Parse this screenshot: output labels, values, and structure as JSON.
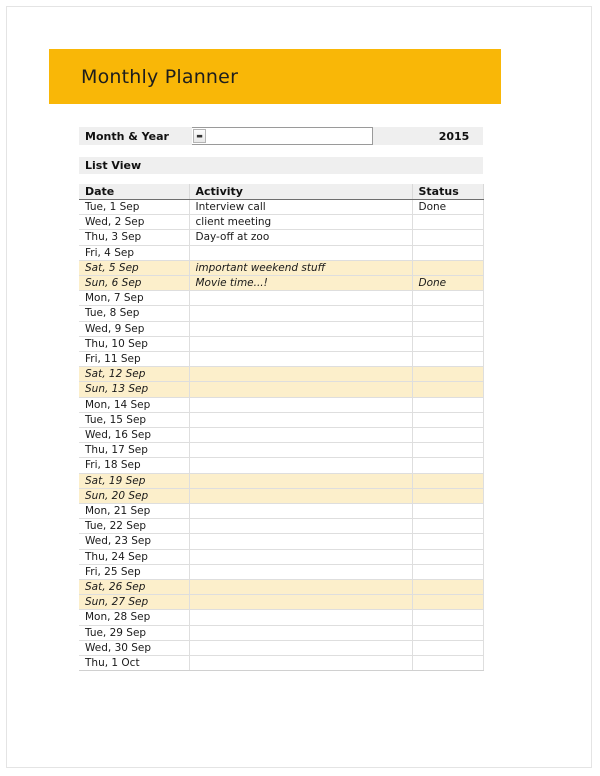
{
  "banner": {
    "title": "Monthly Planner",
    "bg_color": "#f9b707"
  },
  "month_year": {
    "label": "Month & Year",
    "dropdown_icon": "chevron-down-icon",
    "dropdown_glyph": "▬",
    "month_value": "",
    "month_placeholder": "",
    "year": "2015"
  },
  "list_view": {
    "label": "List View"
  },
  "table": {
    "columns": [
      "Date",
      "Activity",
      "Status"
    ],
    "weekend_bg": "#fcefcb",
    "rows": [
      {
        "date": "Tue, 1 Sep",
        "activity": "Interview call",
        "status": "Done",
        "weekend": false
      },
      {
        "date": "Wed, 2 Sep",
        "activity": "client meeting",
        "status": "",
        "weekend": false
      },
      {
        "date": "Thu, 3 Sep",
        "activity": "Day-off at zoo",
        "status": "",
        "weekend": false
      },
      {
        "date": "Fri, 4 Sep",
        "activity": "",
        "status": "",
        "weekend": false
      },
      {
        "date": "Sat, 5 Sep",
        "activity": "important weekend stuff",
        "status": "",
        "weekend": true
      },
      {
        "date": "Sun, 6 Sep",
        "activity": "Movie time...!",
        "status": "Done",
        "weekend": true
      },
      {
        "date": "Mon, 7 Sep",
        "activity": "",
        "status": "",
        "weekend": false
      },
      {
        "date": "Tue, 8 Sep",
        "activity": "",
        "status": "",
        "weekend": false
      },
      {
        "date": "Wed, 9 Sep",
        "activity": "",
        "status": "",
        "weekend": false
      },
      {
        "date": "Thu, 10 Sep",
        "activity": "",
        "status": "",
        "weekend": false
      },
      {
        "date": "Fri, 11 Sep",
        "activity": "",
        "status": "",
        "weekend": false
      },
      {
        "date": "Sat, 12 Sep",
        "activity": "",
        "status": "",
        "weekend": true
      },
      {
        "date": "Sun, 13 Sep",
        "activity": "",
        "status": "",
        "weekend": true
      },
      {
        "date": "Mon, 14 Sep",
        "activity": "",
        "status": "",
        "weekend": false
      },
      {
        "date": "Tue, 15 Sep",
        "activity": "",
        "status": "",
        "weekend": false
      },
      {
        "date": "Wed, 16 Sep",
        "activity": "",
        "status": "",
        "weekend": false
      },
      {
        "date": "Thu, 17 Sep",
        "activity": "",
        "status": "",
        "weekend": false
      },
      {
        "date": "Fri, 18 Sep",
        "activity": "",
        "status": "",
        "weekend": false
      },
      {
        "date": "Sat, 19 Sep",
        "activity": "",
        "status": "",
        "weekend": true
      },
      {
        "date": "Sun, 20 Sep",
        "activity": "",
        "status": "",
        "weekend": true
      },
      {
        "date": "Mon, 21 Sep",
        "activity": "",
        "status": "",
        "weekend": false
      },
      {
        "date": "Tue, 22 Sep",
        "activity": "",
        "status": "",
        "weekend": false
      },
      {
        "date": "Wed, 23 Sep",
        "activity": "",
        "status": "",
        "weekend": false
      },
      {
        "date": "Thu, 24 Sep",
        "activity": "",
        "status": "",
        "weekend": false
      },
      {
        "date": "Fri, 25 Sep",
        "activity": "",
        "status": "",
        "weekend": false
      },
      {
        "date": "Sat, 26 Sep",
        "activity": "",
        "status": "",
        "weekend": true
      },
      {
        "date": "Sun, 27 Sep",
        "activity": "",
        "status": "",
        "weekend": true
      },
      {
        "date": "Mon, 28 Sep",
        "activity": "",
        "status": "",
        "weekend": false
      },
      {
        "date": "Tue, 29 Sep",
        "activity": "",
        "status": "",
        "weekend": false
      },
      {
        "date": "Wed, 30 Sep",
        "activity": "",
        "status": "",
        "weekend": false
      },
      {
        "date": "Thu, 1 Oct",
        "activity": "",
        "status": "",
        "weekend": false
      }
    ]
  }
}
